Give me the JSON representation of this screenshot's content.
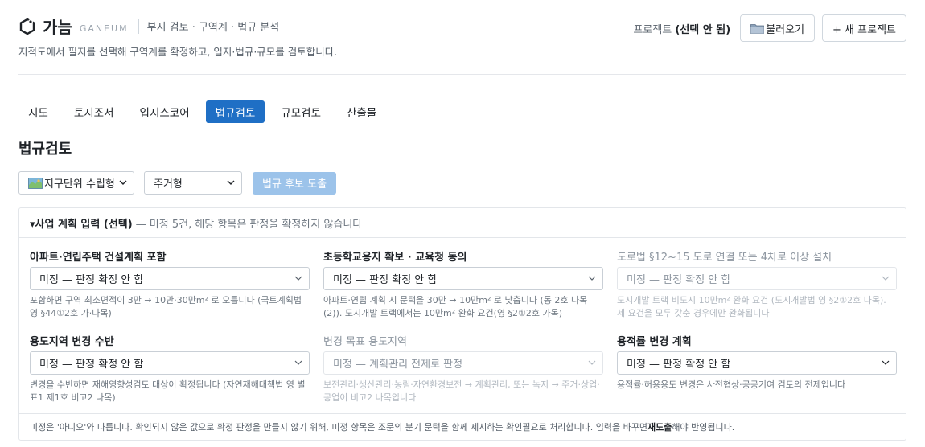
{
  "app": {
    "name": "가늠",
    "name_sub": "GANEUM",
    "description": "부지 검토 · 구역계 · 법규 분석",
    "subtitle": "지적도에서 필지를 선택해 구역계를 확정하고, 입지·법규·규모를 검토합니다."
  },
  "project": {
    "label": "프로젝트",
    "value": "(선택 안 됨)",
    "load_label": "불러오기",
    "new_label": "+ 새 프로젝트"
  },
  "tabs": [
    {
      "label": "지도",
      "active": false
    },
    {
      "label": "토지조서",
      "active": false
    },
    {
      "label": "입지스코어",
      "active": false
    },
    {
      "label": "법규검토",
      "active": true
    },
    {
      "label": "규모검토",
      "active": false
    },
    {
      "label": "산출물",
      "active": false
    }
  ],
  "section_title": "법규검토",
  "filters": {
    "type_value": "지구단위 수립형",
    "use_value": "주거형",
    "derive_label": "법규 후보 도출"
  },
  "panel": {
    "toggle": "▾",
    "title": "사업 계획 입력 (선택)",
    "note": "— 미정 5건, 해당 항목은 판정을 확정하지 않습니다",
    "fields": [
      {
        "label": "아파트·연립주택 건설계획 포함",
        "value": "미정 — 판정 확정 안 함",
        "help": "포함하면 구역 최소면적이 3만 → 10만·30만m² 로 오릅니다 (국토계획법 영 §44①2호 가·나목)",
        "disabled": false
      },
      {
        "label": "초등학교용지 확보 · 교육청 동의",
        "value": "미정 — 판정 확정 안 함",
        "help": "아파트·연립 계획 시 문턱을 30만 → 10만m² 로 낮춥니다 (동 2호 나목(2)). 도시개발 트랙에서는 10만m² 완화 요건(영 §2①2호 가목)",
        "disabled": false
      },
      {
        "label": "도로법 §12~15 도로 연결 또는 4차로 이상 설치",
        "value": "미정 — 판정 확정 안 함",
        "help": "도시개발 트랙 비도시 10만m² 완화 요건 (도시개발법 영 §2①2호 나목). 세 요건을 모두 갖춘 경우에만 완화됩니다",
        "disabled": true
      },
      {
        "label": "용도지역 변경 수반",
        "value": "미정 — 판정 확정 안 함",
        "help": "변경을 수반하면 재해영향성검토 대상이 확정됩니다 (자연재해대책법 영 별표1 제1호 비고2 나목)",
        "disabled": false
      },
      {
        "label": "변경 목표 용도지역",
        "value": "미정 — 계획관리 전제로 판정",
        "help": "보전관리·생산관리·농림·자연환경보전 → 계획관리, 또는 녹지 → 주거·상업·공업이 비고2 나목입니다",
        "disabled": true
      },
      {
        "label": "용적률 변경 계획",
        "value": "미정 — 판정 확정 안 함",
        "help": "용적률·허용용도 변경은 사전협상·공공기여 검토의 전제입니다",
        "disabled": false
      }
    ],
    "footer_prefix": "미정은 '아니오'와 다릅니다. 확인되지 않은 값으로 확정 판정을 만들지 않기 위해, 미정 항목은 조문의 분기 문턱을 함께 제시하는 확인필요로 처리합니다. 입력을 바꾸면 ",
    "footer_bold": "재도출",
    "footer_suffix": "해야 반영됩니다."
  },
  "colors": {
    "accent": "#1f6fc5",
    "accent_disabled": "#9cc3ea"
  }
}
